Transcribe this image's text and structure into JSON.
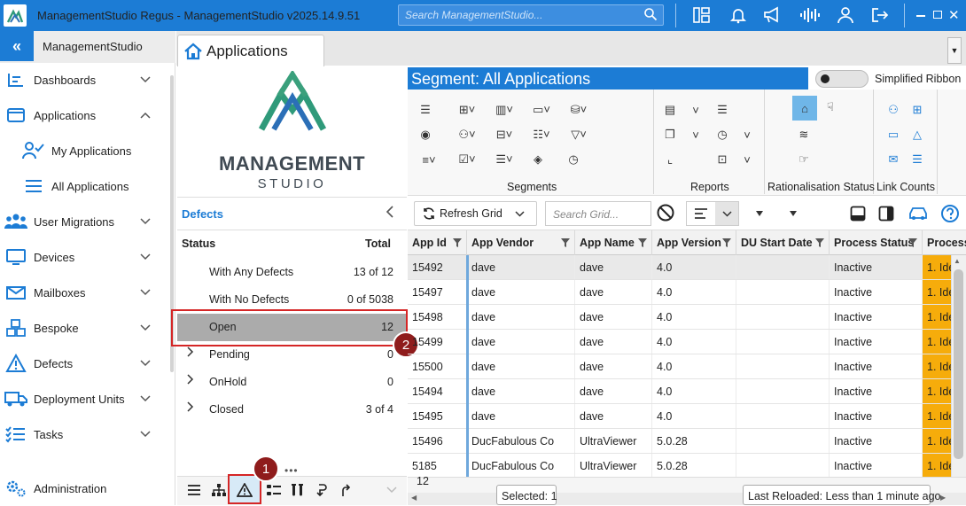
{
  "window": {
    "title": "ManagementStudio Regus - ManagementStudio v2025.14.9.51",
    "search_placeholder": "Search ManagementStudio...",
    "icons": [
      "map-icon",
      "bell-icon",
      "megaphone-icon",
      "audio-wave-icon",
      "user-icon",
      "logout-icon",
      "minimize-icon",
      "maximize-icon",
      "close-icon"
    ]
  },
  "sidebar": {
    "brand": "ManagementStudio",
    "items": [
      {
        "label": "Dashboards",
        "icon": "dashboard-icon",
        "chevron": "down"
      },
      {
        "label": "Applications",
        "icon": "applications-icon",
        "chevron": "up"
      },
      {
        "label": "My Applications",
        "icon": "my-applications-icon",
        "sub": true
      },
      {
        "label": "All Applications",
        "icon": "list-icon",
        "sub": true
      },
      {
        "label": "User Migrations",
        "icon": "users-icon",
        "chevron": "down"
      },
      {
        "label": "Devices",
        "icon": "monitor-icon",
        "chevron": "down"
      },
      {
        "label": "Mailboxes",
        "icon": "mailbox-icon",
        "chevron": "down"
      },
      {
        "label": "Bespoke",
        "icon": "cubes-icon",
        "chevron": "down"
      },
      {
        "label": "Defects",
        "icon": "warning-icon",
        "chevron": "down"
      },
      {
        "label": "Deployment Units",
        "icon": "truck-icon",
        "chevron": "down"
      },
      {
        "label": "Tasks",
        "icon": "tasks-icon",
        "chevron": "down"
      },
      {
        "label": "Administration",
        "icon": "gears-icon"
      }
    ]
  },
  "tab": {
    "label": "Applications"
  },
  "logo": {
    "line1": "MANAGEMENT",
    "line2": "STUDIO"
  },
  "defects": {
    "title": "Defects",
    "col_status": "Status",
    "col_total": "Total",
    "rows": [
      {
        "label": "With Any Defects",
        "value": "13 of 12",
        "expandable": false
      },
      {
        "label": "With No Defects",
        "value": "0 of 5038",
        "expandable": false
      },
      {
        "label": "Open",
        "value": "12",
        "expandable": false,
        "selected": true
      },
      {
        "label": "Pending",
        "value": "0",
        "expandable": true
      },
      {
        "label": "OnHold",
        "value": "0",
        "expandable": true
      },
      {
        "label": "Closed",
        "value": "3 of 4",
        "expandable": true
      }
    ]
  },
  "annotations": {
    "badge1": "1",
    "badge2": "2"
  },
  "segment": {
    "title": "Segment: All Applications"
  },
  "simplified_ribbon": {
    "label": "Simplified Ribbon",
    "on": false
  },
  "ribbon": {
    "groups": [
      "Segments",
      "Reports",
      "Rationalisation Status",
      "Link Counts"
    ]
  },
  "grid_toolbar": {
    "refresh_label": "Refresh Grid",
    "search_placeholder": "Search Grid..."
  },
  "grid": {
    "columns": [
      "App Id",
      "App Vendor",
      "App Name",
      "App Version",
      "DU Start Date",
      "Process Status",
      "Process"
    ],
    "rows": [
      [
        "15492",
        "dave",
        "dave",
        "4.0",
        "",
        "Inactive",
        "1. Ide"
      ],
      [
        "15497",
        "dave",
        "dave",
        "4.0",
        "",
        "Inactive",
        "1. Ide"
      ],
      [
        "15498",
        "dave",
        "dave",
        "4.0",
        "",
        "Inactive",
        "1. Ide"
      ],
      [
        "15499",
        "dave",
        "dave",
        "4.0",
        "",
        "Inactive",
        "1. Ide"
      ],
      [
        "15500",
        "dave",
        "dave",
        "4.0",
        "",
        "Inactive",
        "1. Ide"
      ],
      [
        "15494",
        "dave",
        "dave",
        "4.0",
        "",
        "Inactive",
        "1. Ide"
      ],
      [
        "15495",
        "dave",
        "dave",
        "4.0",
        "",
        "Inactive",
        "1. Ide"
      ],
      [
        "15496",
        "DucFabulous Co",
        "UltraViewer",
        "5.0.28",
        "",
        "Inactive",
        "1. Ide"
      ],
      [
        "5185",
        "DucFabulous Co",
        "UltraViewer",
        "5.0.28",
        "",
        "Inactive",
        "1. Ide"
      ]
    ],
    "row_count": "12",
    "selected_text": "Selected: 1",
    "last_reloaded": "Last Reloaded: Less than 1 minute ago"
  },
  "colors": {
    "accent": "#1c7cd5",
    "highlight": "#d52626",
    "badge": "#8f1c1c",
    "process": "#f6ac0b"
  }
}
